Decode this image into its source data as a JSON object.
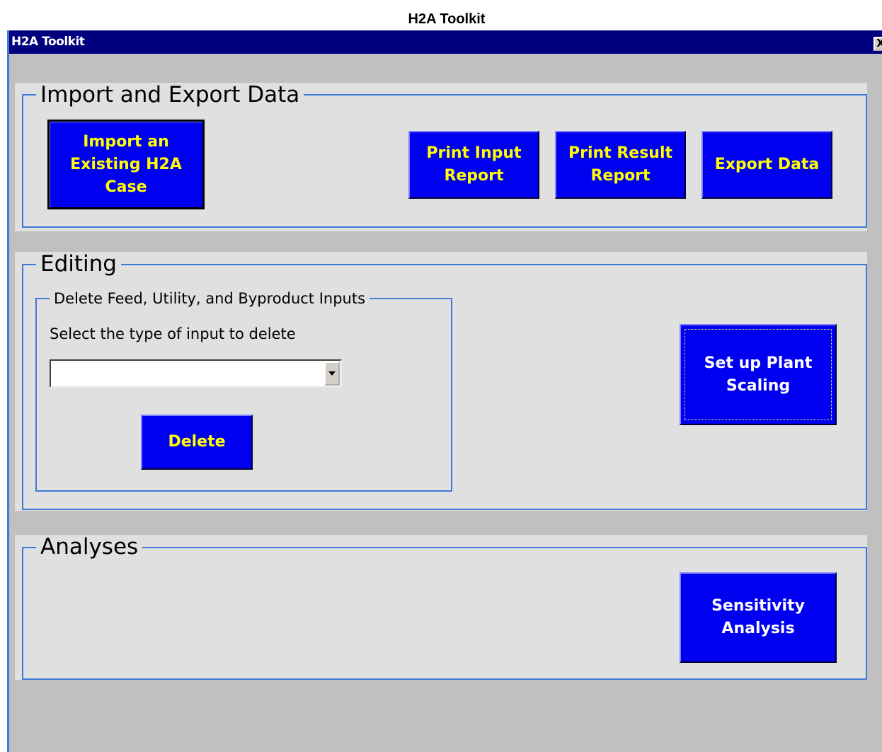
{
  "caption": "H2A Toolkit",
  "window": {
    "title": "H2A Toolkit",
    "close_glyph": "X",
    "close_icon": "close-icon"
  },
  "import_export": {
    "label": "Import and Export Data",
    "import_label": "Import an\nExisting H2A\nCase",
    "print_input_label": "Print Input\nReport",
    "print_result_label": "Print Result\nReport",
    "export_label": "Export Data"
  },
  "editing": {
    "label": "Editing",
    "delete_group": {
      "label": "Delete Feed, Utility, and Byproduct Inputs",
      "prompt": "Select the type of input to delete",
      "select_value": "",
      "delete_label": "Delete"
    },
    "plant_scaling_label": "Set up Plant\nScaling"
  },
  "analyses": {
    "label": "Analyses",
    "sensitivity_label": "Sensitivity\nAnalysis"
  },
  "colors": {
    "button_bg": "#0000f0",
    "button_text_yellow": "#ffff00",
    "button_text_white": "#ffffff",
    "titlebar": "#00007f",
    "frame_border": "#3f7bd6",
    "panel_bg": "#e0e0e0",
    "window_bg": "#c0c0c0"
  }
}
